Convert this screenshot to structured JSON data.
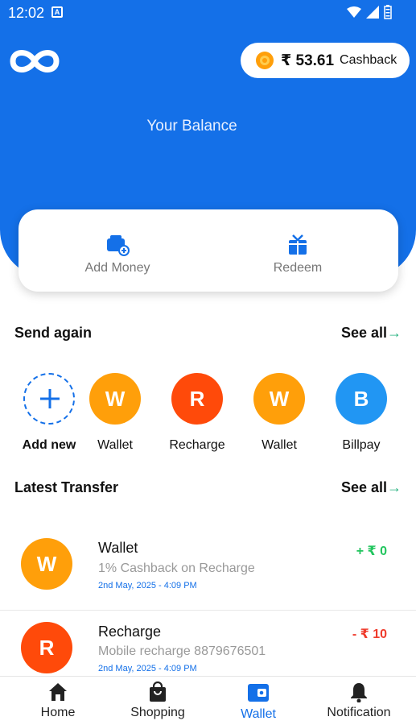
{
  "status_bar": {
    "time": "12:02"
  },
  "cashback": {
    "amount": "₹ 53.61",
    "label": "Cashback"
  },
  "balance": {
    "title": "Your Balance"
  },
  "actions": [
    {
      "label": "Add Money",
      "icon": "wallet-add-icon"
    },
    {
      "label": "Redeem",
      "icon": "gift-icon"
    }
  ],
  "send_again": {
    "title": "Send again",
    "see_all": "See all",
    "add_new_label": "Add new",
    "contacts": [
      {
        "initial": "W",
        "name": "Wallet",
        "color": "#ff9f0a"
      },
      {
        "initial": "R",
        "name": "Recharge",
        "color": "#ff4a0a"
      },
      {
        "initial": "W",
        "name": "Wallet",
        "color": "#ff9f0a"
      },
      {
        "initial": "B",
        "name": "Billpay",
        "color": "#2196f3"
      }
    ]
  },
  "latest_transfer": {
    "title": "Latest Transfer",
    "see_all": "See all",
    "items": [
      {
        "initial": "W",
        "title": "Wallet",
        "description": "1% Cashback on Recharge",
        "date": "2nd May, 2025 - 4:09 PM",
        "amount": "+ ₹ 0",
        "amount_color": "#22c55e",
        "avatar_color": "#ff9f0a"
      },
      {
        "initial": "R",
        "title": "Recharge",
        "description": "Mobile recharge 8879676501",
        "date": "2nd May, 2025 - 4:09 PM",
        "amount": "- ₹ 10",
        "amount_color": "#ef3b2c",
        "avatar_color": "#ff4a0a"
      }
    ]
  },
  "bottom_nav": [
    {
      "label": "Home",
      "icon": "home-icon"
    },
    {
      "label": "Shopping",
      "icon": "shopping-bag-icon"
    },
    {
      "label": "Wallet",
      "icon": "wallet-icon",
      "active": true
    },
    {
      "label": "Notification",
      "icon": "bell-icon"
    }
  ],
  "colors": {
    "primary": "#1470e8",
    "success": "#22c55e",
    "danger": "#ef3b2c",
    "orange": "#ff9f0a"
  }
}
